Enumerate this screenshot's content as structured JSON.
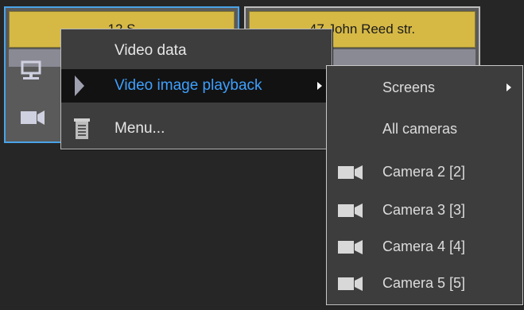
{
  "tiles": [
    {
      "header": "12 S"
    },
    {
      "header": "47 John Reed str."
    }
  ],
  "context_menu": {
    "items": [
      {
        "label": "Video data",
        "icon": ""
      },
      {
        "label": "Video image playback",
        "icon": "play-icon",
        "has_submenu": true,
        "highlighted": true
      },
      {
        "label": "Menu...",
        "icon": "document-icon"
      }
    ]
  },
  "submenu": {
    "items": [
      {
        "label": "Screens",
        "has_submenu": true
      },
      {
        "label": "All cameras"
      },
      {
        "label": "Camera 2 [2]",
        "icon": "camera-icon"
      },
      {
        "label": "Camera 3 [3]",
        "icon": "camera-icon"
      },
      {
        "label": "Camera 4 [4]",
        "icon": "camera-icon"
      },
      {
        "label": "Camera 5 [5]",
        "icon": "camera-icon"
      }
    ]
  },
  "colors": {
    "tile_header": "#d6b945",
    "selected_border": "#4aa3e8",
    "highlight_text": "#3ea0ff",
    "menu_bg": "#3d3d3d"
  }
}
